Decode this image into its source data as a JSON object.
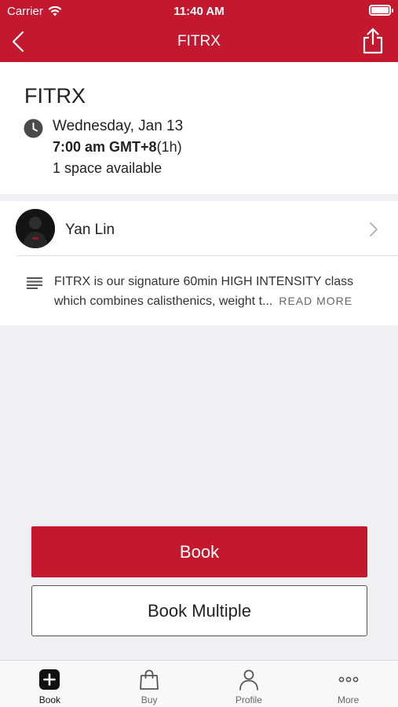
{
  "status_bar": {
    "carrier": "Carrier",
    "time": "11:40 AM"
  },
  "nav": {
    "title": "FITRX"
  },
  "class_info": {
    "title": "FITRX",
    "date": "Wednesday, Jan 13",
    "time": "7:00 am GMT+8",
    "duration": "(1h)",
    "availability": "1 space available"
  },
  "instructor": {
    "name": "Yan Lin"
  },
  "description": {
    "text": "FITRX is our signature 60min HIGH INTENSITY class which combines calisthenics, weight t...",
    "read_more": "READ MORE"
  },
  "actions": {
    "book": "Book",
    "book_multiple": "Book Multiple"
  },
  "tabs": [
    {
      "label": "Book",
      "icon": "plus-square-icon"
    },
    {
      "label": "Buy",
      "icon": "shopping-bag-icon"
    },
    {
      "label": "Profile",
      "icon": "person-icon"
    },
    {
      "label": "More",
      "icon": "more-dots-icon"
    }
  ],
  "colors": {
    "brand": "#c4182e"
  }
}
